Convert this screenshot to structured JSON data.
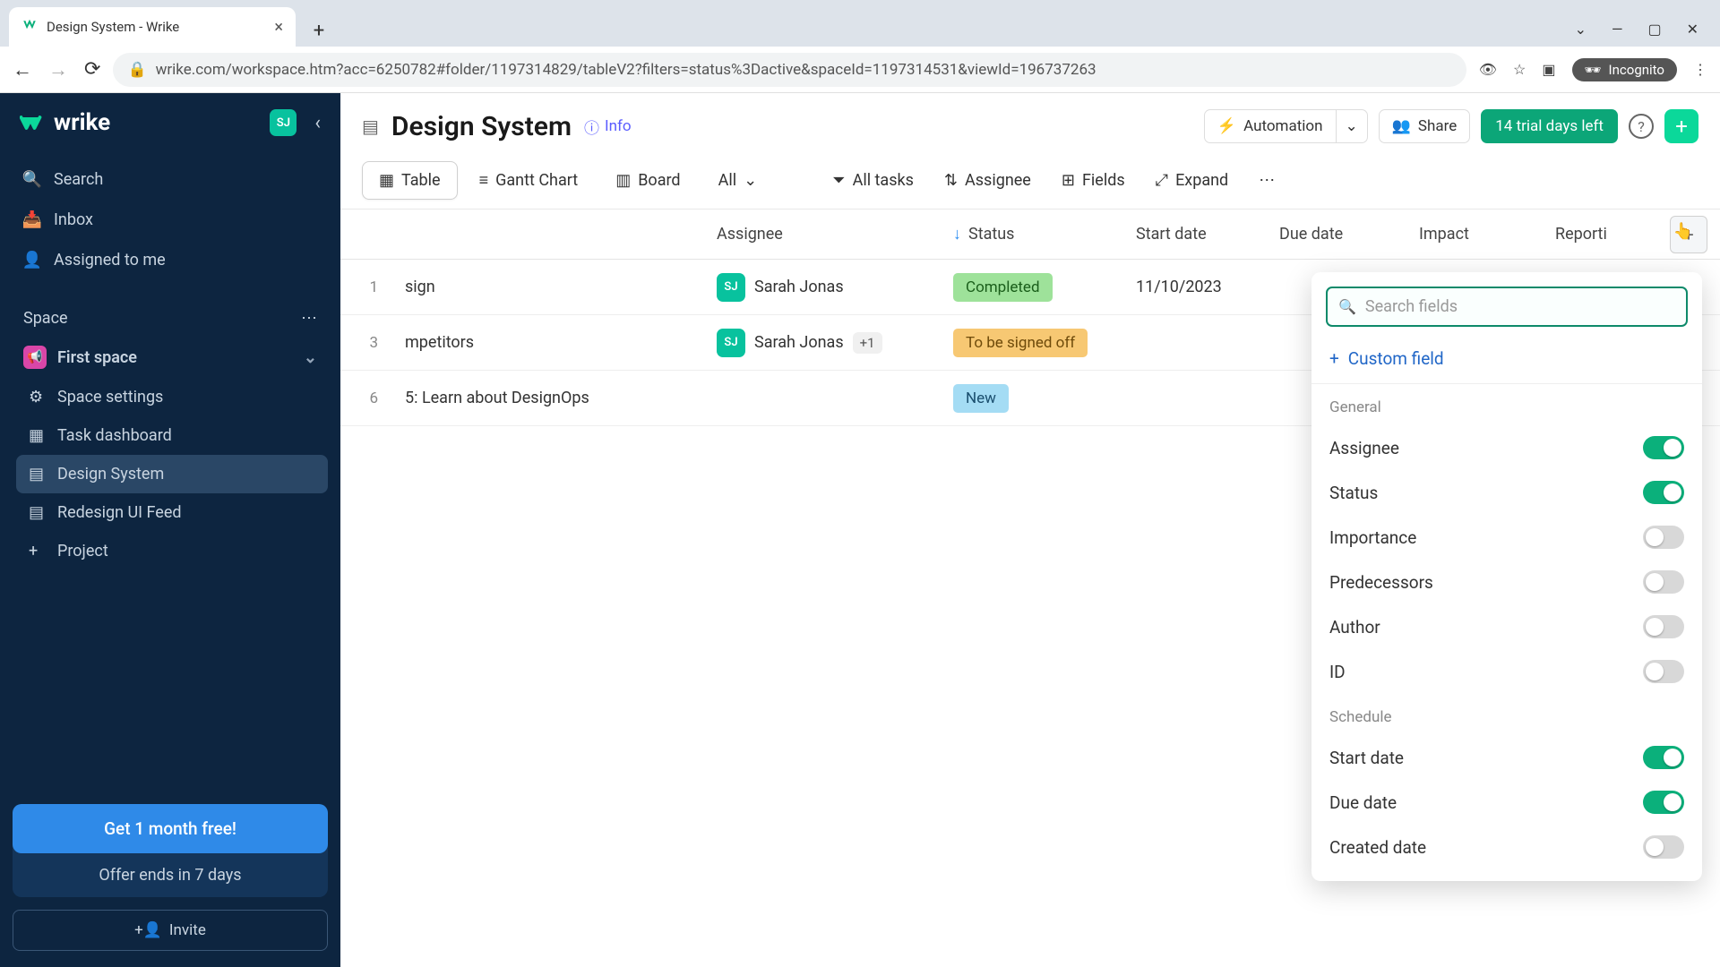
{
  "browser": {
    "tab_title": "Design System - Wrike",
    "url": "wrike.com/workspace.htm?acc=6250782#folder/1197314829/tableV2?filters=status%3Dactive&spaceId=1197314531&viewId=196737263",
    "incognito_label": "Incognito"
  },
  "sidebar": {
    "brand": "wrike",
    "user_initials": "SJ",
    "nav": {
      "search": "Search",
      "inbox": "Inbox",
      "assigned": "Assigned to me"
    },
    "space_label": "Space",
    "space_name": "First space",
    "items": [
      {
        "label": "Space settings"
      },
      {
        "label": "Task dashboard"
      },
      {
        "label": "Design System"
      },
      {
        "label": "Redesign UI Feed"
      }
    ],
    "add_project": "Project",
    "promo_button": "Get 1 month free!",
    "promo_sub": "Offer ends in 7 days",
    "invite": "Invite"
  },
  "header": {
    "title": "Design System",
    "info": "Info",
    "automation": "Automation",
    "share": "Share",
    "trial": "14 trial days left"
  },
  "viewbar": {
    "table": "Table",
    "gantt": "Gantt Chart",
    "board": "Board",
    "all": "All",
    "all_tasks": "All tasks",
    "assignee": "Assignee",
    "fields": "Fields",
    "expand": "Expand"
  },
  "columns": {
    "assignee": "Assignee",
    "status": "Status",
    "start_date": "Start date",
    "due_date": "Due date",
    "impact": "Impact",
    "reporting": "Reporti"
  },
  "rows": [
    {
      "num": "1",
      "name": "sign",
      "assignee": "Sarah Jonas",
      "avatar": "SJ",
      "more": "",
      "status": "Completed",
      "status_class": "completed",
      "start_date": "11/10/2023"
    },
    {
      "num": "3",
      "name": "mpetitors",
      "assignee": "Sarah Jonas",
      "avatar": "SJ",
      "more": "+1",
      "status": "To be signed off",
      "status_class": "signoff",
      "start_date": ""
    },
    {
      "num": "6",
      "name": "5: Learn about DesignOps",
      "assignee": "",
      "avatar": "",
      "more": "",
      "status": "New",
      "status_class": "new",
      "start_date": ""
    }
  ],
  "fields_popup": {
    "search_placeholder": "Search fields",
    "custom_field": "Custom field",
    "general_label": "General",
    "schedule_label": "Schedule",
    "general_fields": [
      {
        "label": "Assignee",
        "on": true
      },
      {
        "label": "Status",
        "on": true
      },
      {
        "label": "Importance",
        "on": false
      },
      {
        "label": "Predecessors",
        "on": false
      },
      {
        "label": "Author",
        "on": false
      },
      {
        "label": "ID",
        "on": false
      }
    ],
    "schedule_fields": [
      {
        "label": "Start date",
        "on": true
      },
      {
        "label": "Due date",
        "on": true
      },
      {
        "label": "Created date",
        "on": false
      }
    ]
  }
}
